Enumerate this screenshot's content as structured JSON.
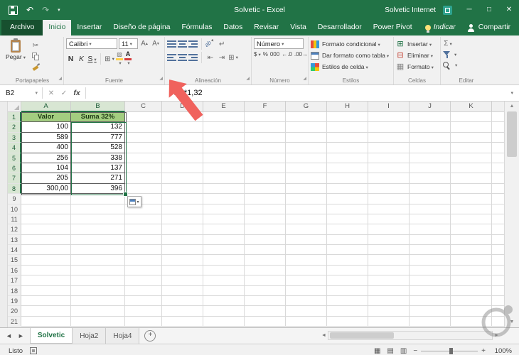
{
  "titlebar": {
    "title": "Solvetic  -  Excel",
    "account": "Solvetic Internet"
  },
  "icons": {
    "undo": "↶",
    "redo": "↷",
    "cut": "✂",
    "cancel": "✕",
    "accept": "✓",
    "fx": "fx",
    "autosum": "Σ",
    "borders": "⊞",
    "wrap": "↵",
    "indent_dec": "⇤",
    "indent_inc": "⇥",
    "orientation": "ab",
    "insert": "⊞",
    "delete": "⊟",
    "format": "▦",
    "views": [
      "▦",
      "▤",
      "▥"
    ],
    "minimize": "─",
    "maximize": "□",
    "close": "✕"
  },
  "ribbon": {
    "tabs": [
      "Archivo",
      "Inicio",
      "Insertar",
      "Diseño de página",
      "Fórmulas",
      "Datos",
      "Revisar",
      "Vista",
      "Desarrollador",
      "Power Pivot"
    ],
    "active_tab": "Inicio",
    "file_tab": "Archivo",
    "tell_me": "Indicar",
    "share": "Compartir",
    "groups": {
      "clipboard": {
        "caption": "Portapapeles",
        "paste": "Pegar"
      },
      "font": {
        "caption": "Fuente",
        "name": "Calibri",
        "size": "11",
        "bold": "N",
        "italic": "K",
        "underline": "S",
        "grow": "A",
        "shrink": "A"
      },
      "alignment": {
        "caption": "Alineación"
      },
      "number": {
        "caption": "Número",
        "format": "Número",
        "currency": "$",
        "percent": "%",
        "thousands": "000",
        "inc_dec": "←.0",
        "dec_dec": ".00→"
      },
      "styles": {
        "caption": "Estilos",
        "items": [
          "Formato condicional",
          "Dar formato como tabla",
          "Estilos de celda"
        ]
      },
      "cells": {
        "caption": "Celdas",
        "items": [
          "Insertar",
          "Eliminar",
          "Formato"
        ]
      },
      "editing": {
        "caption": "Editar"
      }
    }
  },
  "formula_bar": {
    "name_box": "B2",
    "formula": "=A2*1,32"
  },
  "sheet": {
    "columns": [
      "A",
      "B",
      "C",
      "D",
      "E",
      "F",
      "G",
      "H",
      "I",
      "J",
      "K"
    ],
    "visible_rows": 21,
    "selection": "B2",
    "table": {
      "headers": [
        "Valor",
        "Suma 32%"
      ],
      "rows": [
        [
          "100",
          "132"
        ],
        [
          "589",
          "777"
        ],
        [
          "400",
          "528"
        ],
        [
          "256",
          "338"
        ],
        [
          "104",
          "137"
        ],
        [
          "205",
          "271"
        ],
        [
          "300,00",
          "396"
        ]
      ]
    }
  },
  "sheet_tabs": {
    "tabs": [
      "Solvetic",
      "Hoja2",
      "Hoja4"
    ],
    "active": "Solvetic",
    "add": "+"
  },
  "status_bar": {
    "mode": "Listo",
    "zoom": "100%"
  },
  "colors": {
    "green": "#217346",
    "table_header": "#a3cd80",
    "arrow": "#f0625d"
  }
}
